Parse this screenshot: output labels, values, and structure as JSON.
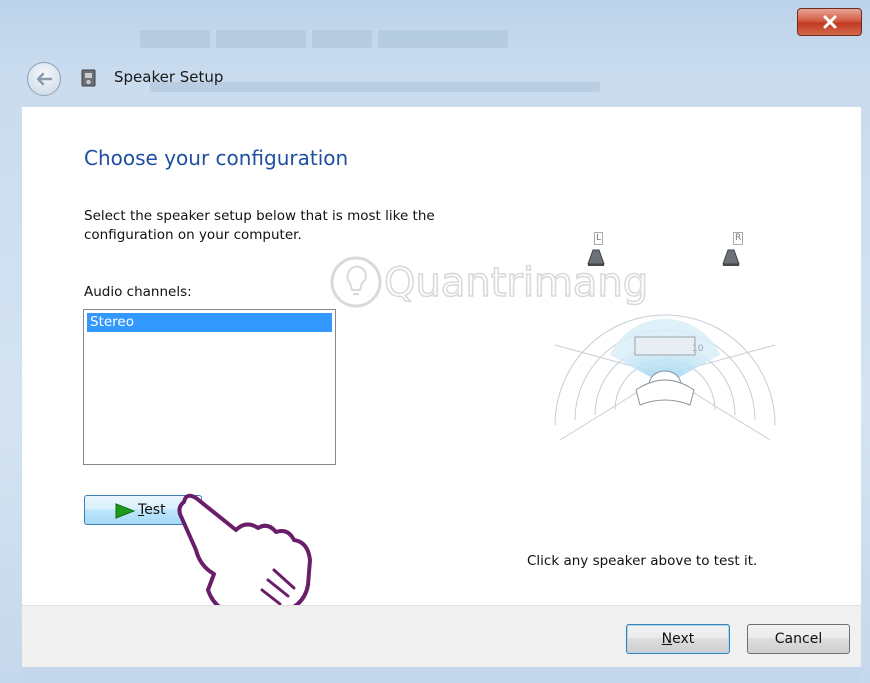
{
  "window": {
    "title": "Speaker Setup",
    "close_icon": "close-icon"
  },
  "page": {
    "heading": "Choose your configuration",
    "description": "Select the speaker setup below that is most like the configuration on your computer.",
    "channels_label": "Audio channels:",
    "channels": [
      {
        "label": "Stereo",
        "selected": true
      }
    ]
  },
  "test_button": {
    "label_prefix": "",
    "accel": "T",
    "label_rest": "est",
    "icon": "play-icon"
  },
  "diagram": {
    "left_speaker_label": "L",
    "right_speaker_label": "R",
    "hint": "Click any speaker above to test it."
  },
  "watermark": {
    "text": "Quantrimang"
  },
  "footer": {
    "next_accel": "N",
    "next_rest": "ext",
    "cancel_label": "Cancel"
  },
  "colors": {
    "heading": "#1f4fa0",
    "selection": "#3399ff",
    "button_focus": "#3c7fb1"
  }
}
